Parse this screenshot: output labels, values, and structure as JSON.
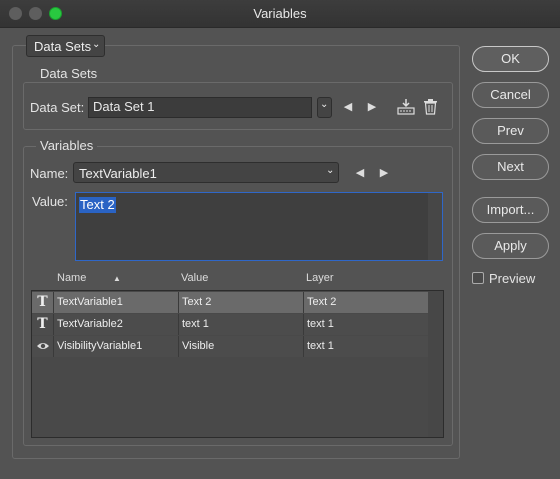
{
  "window": {
    "title": "Variables"
  },
  "mode_dropdown": {
    "label": "Data Sets"
  },
  "data_sets": {
    "section_label": "Data Sets",
    "field_label": "Data Set:",
    "value": "Data Set 1"
  },
  "variables": {
    "section_label": "Variables",
    "name_label": "Name:",
    "name_value": "TextVariable1",
    "value_label": "Value:",
    "value_text": "Text 2"
  },
  "table": {
    "headers": {
      "name": "Name",
      "value": "Value",
      "layer": "Layer"
    },
    "rows": [
      {
        "icon": "text-icon",
        "name": "TextVariable1",
        "value": "Text 2",
        "layer": "Text 2",
        "selected": true
      },
      {
        "icon": "text-icon",
        "name": "TextVariable2",
        "value": "text 1",
        "layer": "text 1",
        "selected": false
      },
      {
        "icon": "eye-icon",
        "name": "VisibilityVariable1",
        "value": "Visible",
        "layer": "text 1",
        "selected": false
      }
    ]
  },
  "buttons": {
    "ok": "OK",
    "cancel": "Cancel",
    "prev": "Prev",
    "next": "Next",
    "import": "Import...",
    "apply": "Apply"
  },
  "preview": {
    "label": "Preview",
    "checked": false
  },
  "colors": {
    "background": "#535353",
    "selection": "#2a63c4",
    "accent_green": "#29c840"
  }
}
